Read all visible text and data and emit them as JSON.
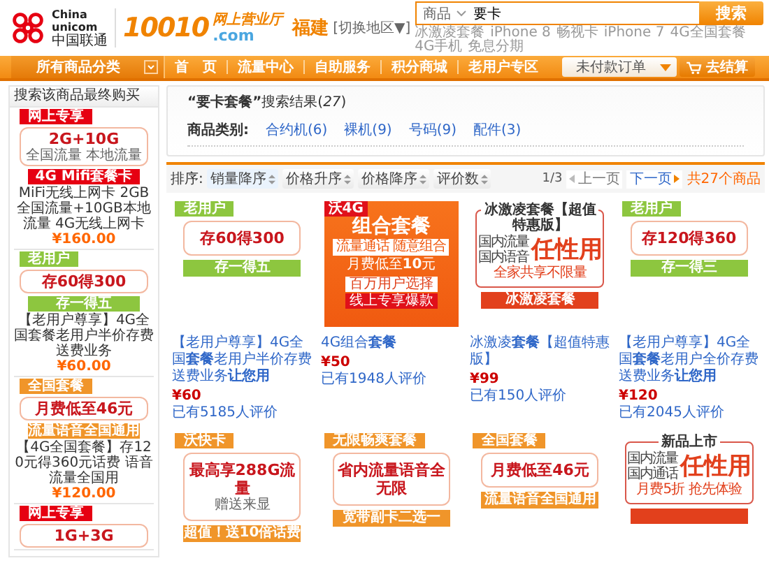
{
  "header": {
    "logo": {
      "lines": [
        "China",
        "unicom"
      ],
      "cn": "中国联通"
    },
    "site": {
      "number": "10010",
      "suffix": ".com",
      "tagline": "网上营业厅"
    },
    "region": {
      "name": "福建",
      "switch": "[切换地区▼]"
    },
    "search": {
      "category": "商品",
      "value": "要卡",
      "button": "搜索",
      "hot": [
        "冰激凌套餐",
        "iPhone 8",
        "畅视卡",
        "iPhone 7",
        "4G全国套餐",
        "4G手机",
        "免息分期"
      ]
    }
  },
  "nav": {
    "all": "所有商品分类",
    "items": [
      "首　页",
      "流量中心",
      "自助服务",
      "积分商城",
      "老用户专区"
    ],
    "orders": "未付款订单",
    "checkout": "去结算"
  },
  "sidebar": {
    "title": "搜索该商品最终购买",
    "items": [
      {
        "banner": {
          "kind": "boxed",
          "tag": {
            "text": "网上专享",
            "color": "#e60012"
          },
          "main": "2G+10G",
          "sub": "全国流量 本地流量",
          "bar": {
            "text": "4G Mifi套餐卡",
            "color": "#e60012"
          }
        },
        "name": "MiFi无线上网卡 2GB全国流量+10GB本地流量 4G无线上网卡",
        "price": "¥160.00"
      },
      {
        "banner": {
          "kind": "boxed",
          "tag": {
            "text": "老用户",
            "color": "#8dc63f"
          },
          "main": "存60得300",
          "bar": {
            "text": "存一得五",
            "color": "#8dc63f"
          }
        },
        "name": "【老用户尊享】4G全国套餐老用户半价存费送费业务",
        "price": "¥60.00"
      },
      {
        "banner": {
          "kind": "boxed",
          "tag": {
            "text": "全国套餐",
            "color": "#f0952a"
          },
          "main": "月费低至46元",
          "bar": {
            "text": "流量语音全国通用",
            "color": "#f0952a"
          }
        },
        "name": "【4G全国套餐】存120元得360元话费 语音流量全国用",
        "price": "¥120.00"
      },
      {
        "banner": {
          "kind": "boxed",
          "tag": {
            "text": "网上专享",
            "color": "#e60012"
          },
          "main": "1G+3G"
        }
      }
    ]
  },
  "summary": {
    "text": "**“要卡套餐”**搜索结果(*27*)",
    "category_label": "商品类别:",
    "categories": [
      "合约机(6)",
      "裸机(9)",
      "号码(9)",
      "配件(3)"
    ]
  },
  "sort": {
    "label": "排序:",
    "options": [
      {
        "label": "销量降序",
        "selected": true
      },
      {
        "label": "价格升序",
        "selected": false
      },
      {
        "label": "价格降序",
        "selected": false
      },
      {
        "label": "评价数",
        "selected": false
      }
    ],
    "page": "1/3",
    "prev": "上一页",
    "next": "下一页",
    "total": "共27个商品"
  },
  "products": [
    {
      "banner": {
        "kind": "boxed",
        "tag": {
          "text": "老用户",
          "color": "#8dc63f"
        },
        "main": "存60得300",
        "bar": {
          "text": "存一得五",
          "color": "#8dc63f"
        }
      },
      "title": "【老用户尊享】4G全国**套餐**老用户半价存费送费业务**让您用**",
      "price": "¥60",
      "reviews": "已有5185人评价"
    },
    {
      "banner": {
        "kind": "orange",
        "corner": "沃4G",
        "main": "组合套餐",
        "line": "流量通话 随意组合",
        "price_line": "月费低至**10**元",
        "labels": [
          "百万用户选择",
          "线上专享爆款"
        ]
      },
      "title": "4G组合**套餐**",
      "price": "¥50",
      "reviews": "已有1948人评价"
    },
    {
      "banner": {
        "kind": "frame",
        "heading": "冰激凌套餐【超值特惠版】",
        "lines": [
          "国内流量",
          "国内语音"
        ],
        "main": "任性用",
        "sub": "全家共享不限量",
        "bar": {
          "text": "冰激凌套餐",
          "color": "#e2401c"
        }
      },
      "title": "冰激凌**套餐**【超值特惠版】",
      "price": "¥99",
      "reviews": "已有150人评价"
    },
    {
      "banner": {
        "kind": "boxed",
        "tag": {
          "text": "老用户",
          "color": "#8dc63f"
        },
        "main": "存120得360",
        "bar": {
          "text": "存一得三",
          "color": "#8dc63f"
        }
      },
      "title": "【老用户尊享】4G全国**套餐**老用户全价存费送费业务**让您用**",
      "price": "¥120",
      "reviews": "已有2045人评价"
    },
    {
      "banner": {
        "kind": "boxed",
        "tag": {
          "text": "沃快卡",
          "color": "#f0952a"
        },
        "main": "最高享288G流量",
        "sub": "赠送来显",
        "bar": {
          "text": "超值！送10倍话费",
          "color": "#f0952a"
        }
      }
    },
    {
      "banner": {
        "kind": "boxed",
        "tag": {
          "text": "无限畅爽套餐",
          "color": "#f0952a"
        },
        "main": "省内流量语音全无限",
        "bar": {
          "text": "宽带副卡二选一",
          "color": "#f0952a"
        }
      }
    },
    {
      "banner": {
        "kind": "boxed",
        "tag": {
          "text": "全国套餐",
          "color": "#f0952a"
        },
        "main": "月费低至46元",
        "bar": {
          "text": "流量语音全国通用",
          "color": "#f0952a"
        }
      }
    },
    {
      "banner": {
        "kind": "frame",
        "heading": "新品上市",
        "lines": [
          "国内流量",
          "国内通话"
        ],
        "main": "任性用",
        "sub": "月费5折 抢先体验",
        "bar": {
          "color": "#e2401c"
        }
      }
    }
  ]
}
